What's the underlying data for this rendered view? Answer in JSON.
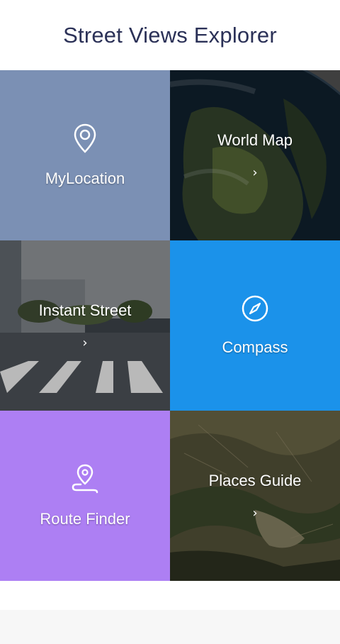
{
  "header": {
    "title": "Street Views Explorer"
  },
  "tiles": {
    "mylocation": {
      "label": "MyLocation",
      "icon": "location-pin-icon",
      "color": "#7b90b4"
    },
    "worldmap": {
      "label": "World Map",
      "chevron": "›",
      "background": "earth-image"
    },
    "instantstreet": {
      "label": "Instant Street",
      "chevron": "›",
      "background": "street-crosswalk-image"
    },
    "compass": {
      "label": "Compass",
      "icon": "compass-icon",
      "color": "#1b92ea"
    },
    "routefinder": {
      "label": "Route Finder",
      "icon": "route-pin-icon",
      "color": "#ad7ff3"
    },
    "placesguide": {
      "label": "Places Guide",
      "chevron": "›",
      "background": "aerial-terrain-image"
    }
  }
}
